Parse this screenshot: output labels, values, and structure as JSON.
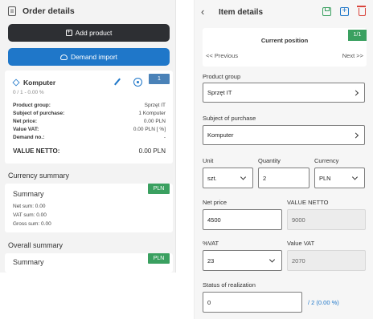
{
  "left": {
    "title": "Order details",
    "add_product": "Add product",
    "demand_import": "Demand import",
    "product": {
      "name": "Komputer",
      "subline": "0 / 1 - 0.00 %",
      "qty_badge": "1",
      "rows": [
        {
          "key": "Product group:",
          "value": "Sprzęt IT"
        },
        {
          "key": "Subject of purchase:",
          "value": "1 Komputer"
        },
        {
          "key": "Net price:",
          "value": "0.00 PLN"
        },
        {
          "key": "Value VAT:",
          "value": "0.00 PLN [ %]"
        },
        {
          "key": "Demand no.:",
          "value": "-"
        }
      ],
      "total_label": "VALUE NETTO:",
      "total_value": "0.00 PLN"
    },
    "currency_summary": {
      "section_title": "Currency summary",
      "card_title": "Summary",
      "badge": "PLN",
      "net_sum": "Net sum: 0.00",
      "vat_sum": "VAT sum: 0.00",
      "gross_sum": "Gross sum: 0.00"
    },
    "overall_summary": {
      "section_title": "Overall summary",
      "card_title": "Summary",
      "badge": "PLN"
    }
  },
  "right": {
    "title": "Item details",
    "position": {
      "title": "Current position",
      "badge": "1/1",
      "previous": "<< Previous",
      "next": "Next >>"
    },
    "product_group": {
      "label": "Product group",
      "value": "Sprzęt IT"
    },
    "subject": {
      "label": "Subject of purchase",
      "value": "Komputer"
    },
    "unit": {
      "label": "Unit",
      "value": "szt."
    },
    "quantity": {
      "label": "Quantity",
      "value": "2"
    },
    "currency": {
      "label": "Currency",
      "value": "PLN"
    },
    "net_price": {
      "label": "Net price",
      "value": "4500"
    },
    "value_netto": {
      "label": "VALUE NETTO",
      "value": "9000"
    },
    "vat_percent": {
      "label": "%VAT",
      "value": "23"
    },
    "value_vat": {
      "label": "Value VAT",
      "value": "2070"
    },
    "status": {
      "label": "Status of realization",
      "value": "0",
      "extra": "/ 2 (0.00 %)"
    }
  },
  "colors": {
    "dark_button": "#2d2f33",
    "blue": "#1f77c9",
    "green": "#3aa060",
    "red": "#d9443c"
  },
  "icons": [
    "document-icon",
    "plus-box-icon",
    "cloud-icon",
    "cube-icon",
    "pencil-icon",
    "gear-icon",
    "back-arrow-icon",
    "save-icon",
    "add-box-icon",
    "trash-icon",
    "chevron-right-icon",
    "chevron-down-icon"
  ]
}
